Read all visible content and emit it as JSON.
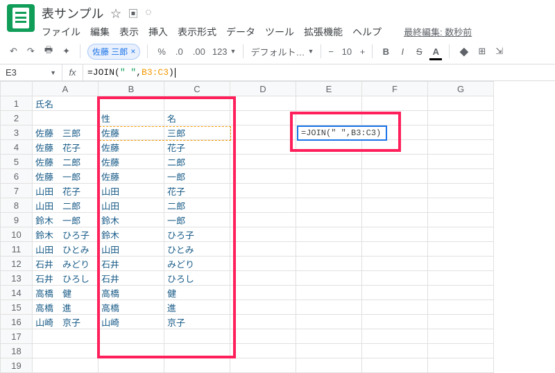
{
  "doc_title": "表サンプル",
  "menus": [
    "ファイル",
    "編集",
    "表示",
    "挿入",
    "表示形式",
    "データ",
    "ツール",
    "拡張機能",
    "ヘルプ"
  ],
  "last_edit": "最終編集: 数秒前",
  "toolbar": {
    "chip_text": "佐藤 三郎",
    "percent": "%",
    "dec0": ".0",
    "dec00": ".00",
    "num_fmt": "123",
    "font": "デフォルト…",
    "size": "10"
  },
  "namebox": "E3",
  "formula": {
    "prefix": "=JOIN(",
    "str": "\" \"",
    "comma": ",",
    "range": "B3:C3",
    "suffix": ")"
  },
  "cell_formula": {
    "prefix": "=JOIN(",
    "str": "\" \"",
    "comma": ",",
    "range": "B3:C3",
    "suffix": ")"
  },
  "columns": [
    "A",
    "B",
    "C",
    "D",
    "E",
    "F",
    "G"
  ],
  "rows": [
    {
      "n": 1,
      "a": "氏名",
      "b": "",
      "c": ""
    },
    {
      "n": 2,
      "a": "",
      "b": "性",
      "c": "名"
    },
    {
      "n": 3,
      "a": "佐藤　三郎",
      "b": "佐藤",
      "c": "三郎"
    },
    {
      "n": 4,
      "a": "佐藤　花子",
      "b": "佐藤",
      "c": "花子"
    },
    {
      "n": 5,
      "a": "佐藤　二郎",
      "b": "佐藤",
      "c": "二郎"
    },
    {
      "n": 6,
      "a": "佐藤　一郎",
      "b": "佐藤",
      "c": "一郎"
    },
    {
      "n": 7,
      "a": "山田　花子",
      "b": "山田",
      "c": "花子"
    },
    {
      "n": 8,
      "a": "山田　二郎",
      "b": "山田",
      "c": "二郎"
    },
    {
      "n": 9,
      "a": "鈴木　一郎",
      "b": "鈴木",
      "c": "一郎"
    },
    {
      "n": 10,
      "a": "鈴木　ひろ子",
      "b": "鈴木",
      "c": "ひろ子"
    },
    {
      "n": 11,
      "a": "山田　ひとみ",
      "b": "山田",
      "c": "ひとみ"
    },
    {
      "n": 12,
      "a": "石井　みどり",
      "b": "石井",
      "c": "みどり"
    },
    {
      "n": 13,
      "a": "石井　ひろし",
      "b": "石井",
      "c": "ひろし"
    },
    {
      "n": 14,
      "a": "高橋　健",
      "b": "高橋",
      "c": "健"
    },
    {
      "n": 15,
      "a": "高橋　進",
      "b": "高橋",
      "c": "進"
    },
    {
      "n": 16,
      "a": "山崎　京子",
      "b": "山崎",
      "c": "京子"
    },
    {
      "n": 17,
      "a": "",
      "b": "",
      "c": ""
    },
    {
      "n": 18,
      "a": "",
      "b": "",
      "c": ""
    },
    {
      "n": 19,
      "a": "",
      "b": "",
      "c": ""
    }
  ]
}
